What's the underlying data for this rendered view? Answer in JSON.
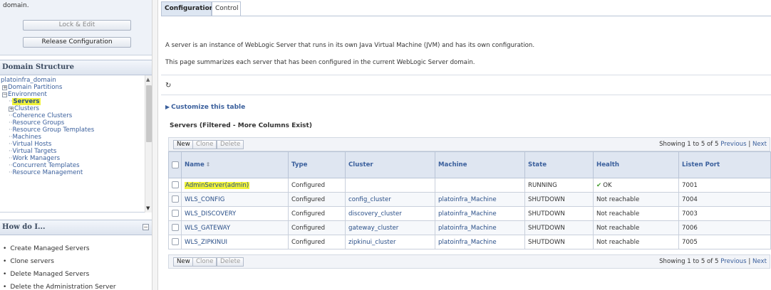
{
  "change_center": {
    "text": "domain.",
    "lock_edit": "Lock & Edit",
    "release_config": "Release Configuration"
  },
  "domain_structure": {
    "title": "Domain Structure",
    "items": [
      {
        "label": "platoinfra_domain"
      },
      {
        "label": "Domain Partitions"
      },
      {
        "label": "Environment"
      },
      {
        "label": "Servers"
      },
      {
        "label": "Clusters"
      },
      {
        "label": "Coherence Clusters"
      },
      {
        "label": "Resource Groups"
      },
      {
        "label": "Resource Group Templates"
      },
      {
        "label": "Machines"
      },
      {
        "label": "Virtual Hosts"
      },
      {
        "label": "Virtual Targets"
      },
      {
        "label": "Work Managers"
      },
      {
        "label": "Concurrent Templates"
      },
      {
        "label": "Resource Management"
      }
    ]
  },
  "how_do_i": {
    "title": "How do I...",
    "links": [
      "Create Managed Servers",
      "Clone servers",
      "Delete Managed Servers",
      "Delete the Administration Server"
    ]
  },
  "tabs": [
    "Configuration",
    "Control"
  ],
  "description": {
    "line1": "A server is an instance of WebLogic Server that runs in its own Java Virtual Machine (JVM) and has its own configuration.",
    "line2": "This page summarizes each server that has been configured in the current WebLogic Server domain."
  },
  "customize": "Customize this table",
  "table_title": "Servers (Filtered - More Columns Exist)",
  "toolbar": {
    "new": "New",
    "clone": "Clone",
    "delete": "Delete",
    "showing": "Showing 1 to 5 of 5",
    "previous": "Previous",
    "separator": "|",
    "next": "Next"
  },
  "table": {
    "columns": [
      "Name",
      "Type",
      "Cluster",
      "Machine",
      "State",
      "Health",
      "Listen Port"
    ],
    "rows": [
      {
        "name": "AdminServer(admin)",
        "type": "Configured",
        "cluster": "",
        "machine": "",
        "state": "RUNNING",
        "health": "OK",
        "port": "7001"
      },
      {
        "name": "WLS_CONFIG",
        "type": "Configured",
        "cluster": "config_cluster",
        "machine": "platoinfra_Machine",
        "state": "SHUTDOWN",
        "health": "Not reachable",
        "port": "7004"
      },
      {
        "name": "WLS_DISCOVERY",
        "type": "Configured",
        "cluster": "discovery_cluster",
        "machine": "platoinfra_Machine",
        "state": "SHUTDOWN",
        "health": "Not reachable",
        "port": "7003"
      },
      {
        "name": "WLS_GATEWAY",
        "type": "Configured",
        "cluster": "gateway_cluster",
        "machine": "platoinfra_Machine",
        "state": "SHUTDOWN",
        "health": "Not reachable",
        "port": "7006"
      },
      {
        "name": "WLS_ZIPKINUI",
        "type": "Configured",
        "cluster": "zipkinui_cluster",
        "machine": "platoinfra_Machine",
        "state": "SHUTDOWN",
        "health": "Not reachable",
        "port": "7005"
      }
    ]
  },
  "colors": {
    "highlight": "#f1f33a",
    "link": "#3a5f9c",
    "ok": "#3f9a2a"
  }
}
